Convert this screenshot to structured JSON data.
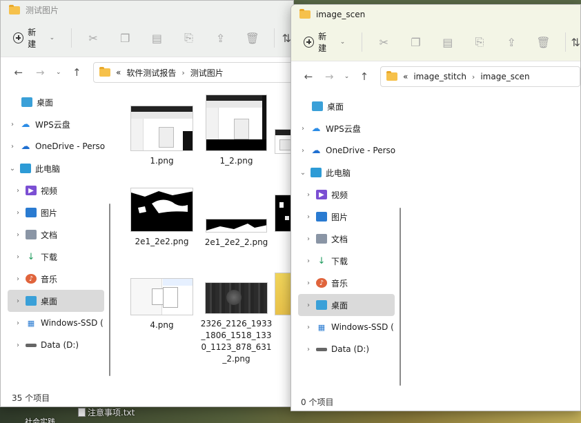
{
  "win1": {
    "title": "测试图片",
    "toolbar": {
      "new_label": "新建"
    },
    "address": {
      "overflow": "«",
      "crumb1": "软件测试报告",
      "crumb2": "测试图片"
    },
    "sidebar": [
      {
        "label": "桌面",
        "icon": "desktop-icon",
        "expand": ""
      },
      {
        "label": "WPS云盘",
        "icon": "cloud-icon",
        "expand": "›"
      },
      {
        "label": "OneDrive - Perso",
        "icon": "onedrive-icon",
        "expand": "›"
      },
      {
        "label": "此电脑",
        "icon": "computer-icon",
        "expand": "⌄"
      },
      {
        "label": "视频",
        "icon": "video-icon",
        "expand": "›"
      },
      {
        "label": "图片",
        "icon": "pictures-icon",
        "expand": "›"
      },
      {
        "label": "文档",
        "icon": "documents-icon",
        "expand": "›"
      },
      {
        "label": "下载",
        "icon": "download-icon",
        "expand": "›"
      },
      {
        "label": "音乐",
        "icon": "music-icon",
        "expand": "›"
      },
      {
        "label": "桌面",
        "icon": "desktop-icon",
        "expand": "›"
      },
      {
        "label": "Windows-SSD (",
        "icon": "drive-windows-icon",
        "expand": "›"
      },
      {
        "label": "Data (D:)",
        "icon": "drive-icon",
        "expand": "›"
      }
    ],
    "files": [
      {
        "name": "1.png"
      },
      {
        "name": "1_2.png"
      },
      {
        "name": "2e1_2e2.png"
      },
      {
        "name": "2e1_2e2_2.png"
      },
      {
        "name": "4.png"
      },
      {
        "name": "2326_2126_1933_1806_1518_1330_1123_878_631_2.png"
      }
    ],
    "status": "35 个项目"
  },
  "win2": {
    "title": "image_scen",
    "toolbar": {
      "new_label": "新建"
    },
    "address": {
      "overflow": "«",
      "crumb1": "image_stitch",
      "crumb2": "image_scen"
    },
    "sidebar": [
      {
        "label": "桌面",
        "icon": "desktop-icon",
        "expand": ""
      },
      {
        "label": "WPS云盘",
        "icon": "cloud-icon",
        "expand": "›"
      },
      {
        "label": "OneDrive - Perso",
        "icon": "onedrive-icon",
        "expand": "›"
      },
      {
        "label": "此电脑",
        "icon": "computer-icon",
        "expand": "⌄"
      },
      {
        "label": "视频",
        "icon": "video-icon",
        "expand": "›"
      },
      {
        "label": "图片",
        "icon": "pictures-icon",
        "expand": "›"
      },
      {
        "label": "文档",
        "icon": "documents-icon",
        "expand": "›"
      },
      {
        "label": "下载",
        "icon": "download-icon",
        "expand": "›"
      },
      {
        "label": "音乐",
        "icon": "music-icon",
        "expand": "›"
      },
      {
        "label": "桌面",
        "icon": "desktop-icon",
        "expand": "›"
      },
      {
        "label": "Windows-SSD (",
        "icon": "drive-windows-icon",
        "expand": "›"
      },
      {
        "label": "Data (D:)",
        "icon": "drive-icon",
        "expand": "›"
      }
    ],
    "status": "0 个项目"
  },
  "desktop": {
    "file_label": "注意事项.txt",
    "partial_label": "社会实践"
  }
}
